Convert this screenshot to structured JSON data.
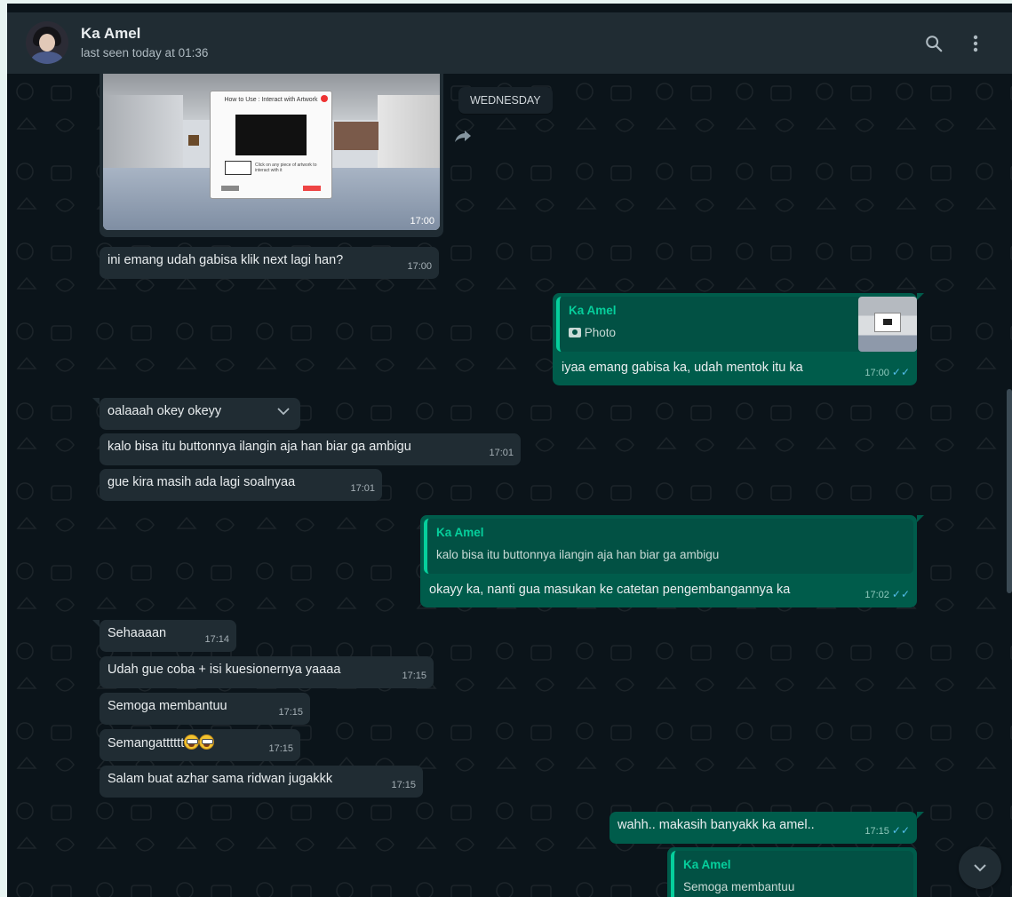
{
  "header": {
    "contact_name": "Ka Amel",
    "status": "last seen today at 01:36",
    "search_icon": "search-icon",
    "menu_icon": "kebab-menu-icon"
  },
  "chat": {
    "date_chip": "WEDNESDAY",
    "image_message": {
      "time": "17:00"
    },
    "messages": [
      {
        "dir": "in",
        "text": "ini emang udah gabisa klik next lagi han?",
        "time": "17:00"
      },
      {
        "dir": "out",
        "quote_author": "Ka Amel",
        "quote_text": "Photo",
        "text": "iyaa emang gabisa ka, udah mentok itu ka",
        "time": "17:00"
      },
      {
        "dir": "in",
        "text": "oalaaah okey okeyy",
        "time": ""
      },
      {
        "dir": "in",
        "text": "kalo bisa itu buttonnya ilangin aja han biar ga ambigu",
        "time": "17:01"
      },
      {
        "dir": "in",
        "text": "gue kira masih ada lagi soalnyaa",
        "time": "17:01"
      },
      {
        "dir": "out",
        "quote_author": "Ka Amel",
        "quote_text": "kalo bisa itu buttonnya ilangin aja han biar ga ambigu",
        "text": "okayy ka, nanti gua masukan ke catetan pengembangannya ka",
        "time": "17:02"
      },
      {
        "dir": "in",
        "text": "Sehaaaan",
        "time": "17:14"
      },
      {
        "dir": "in",
        "text": "Udah gue coba + isi kuesionernya yaaaa",
        "time": "17:15"
      },
      {
        "dir": "in",
        "text": "Semoga membantuu",
        "time": "17:15"
      },
      {
        "dir": "in",
        "text": "Semangatttttt",
        "time": "17:15"
      },
      {
        "dir": "in",
        "text": "Salam buat azhar sama ridwan jugakkk",
        "time": "17:15"
      },
      {
        "dir": "out",
        "text": "wahh.. makasih banyakk ka amel..",
        "time": "17:15"
      },
      {
        "dir": "out",
        "quote_author": "Ka Amel",
        "quote_text": "Semoga membantuu"
      }
    ],
    "image_preview_text": "How to Use : Interact with Artwork",
    "image_hint_text": "Click on any piece of artwork to interact with it"
  },
  "colors": {
    "background": "#0b141a",
    "header": "#202c33",
    "incoming": "#202c33",
    "outgoing": "#005c4b",
    "accent": "#06cf9c",
    "read_ticks": "#53bdeb"
  }
}
